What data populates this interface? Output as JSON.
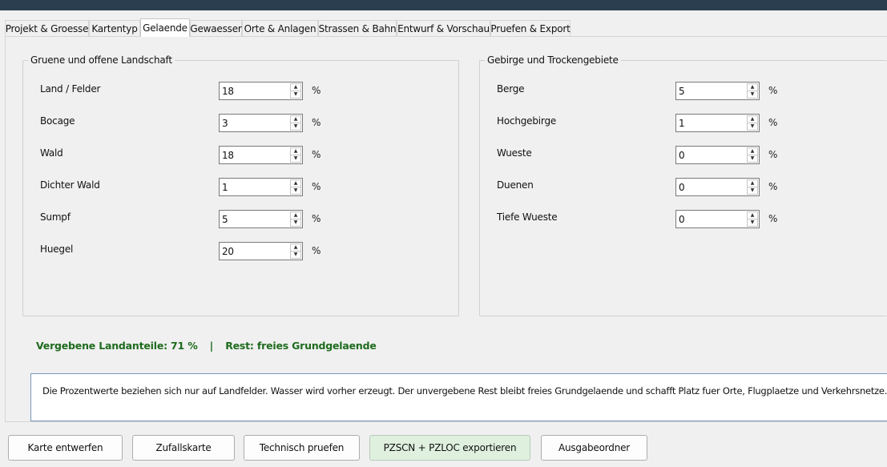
{
  "tabs": [
    {
      "label": "Projekt & Groesse"
    },
    {
      "label": "Kartentyp"
    },
    {
      "label": "Gelaende"
    },
    {
      "label": "Gewaesser"
    },
    {
      "label": "Orte & Anlagen"
    },
    {
      "label": "Strassen & Bahn"
    },
    {
      "label": "Entwurf & Vorschau"
    },
    {
      "label": "Pruefen & Export"
    }
  ],
  "active_tab": "Gelaende",
  "left_group": {
    "title": "Gruene und offene Landschaft",
    "rows": [
      {
        "label": "Land / Felder",
        "value": "18",
        "unit": "%"
      },
      {
        "label": "Bocage",
        "value": "3",
        "unit": "%"
      },
      {
        "label": "Wald",
        "value": "18",
        "unit": "%"
      },
      {
        "label": "Dichter Wald",
        "value": "1",
        "unit": "%"
      },
      {
        "label": "Sumpf",
        "value": "5",
        "unit": "%"
      },
      {
        "label": "Huegel",
        "value": "20",
        "unit": "%"
      }
    ]
  },
  "right_group": {
    "title": "Gebirge und Trockengebiete",
    "rows": [
      {
        "label": "Berge",
        "value": "5",
        "unit": "%"
      },
      {
        "label": "Hochgebirge",
        "value": "1",
        "unit": "%"
      },
      {
        "label": "Wueste",
        "value": "0",
        "unit": "%"
      },
      {
        "label": "Duenen",
        "value": "0",
        "unit": "%"
      },
      {
        "label": "Tiefe Wueste",
        "value": "0",
        "unit": "%"
      }
    ]
  },
  "summary": {
    "allocated": "Vergebene Landanteile: 71 %",
    "separator": "|",
    "rest": "Rest: freies Grundgelaende"
  },
  "info_text": "Die Prozentwerte beziehen sich nur auf Landfelder. Wasser wird vorher erzeugt. Der unvergebene Rest bleibt freies Grundgelaende und schafft Platz fuer Orte, Flugplaetze und Verkehrsnetze.",
  "buttons": {
    "design": "Karte entwerfen",
    "random": "Zufallskarte",
    "check": "Technisch pruefen",
    "export": "PZSCN + PZLOC exportieren",
    "output_folder": "Ausgabeordner"
  },
  "colors": {
    "summary_text": "#1e6b1e",
    "export_button_bg": "#dff0df",
    "titlebar": "#2b3e50"
  }
}
